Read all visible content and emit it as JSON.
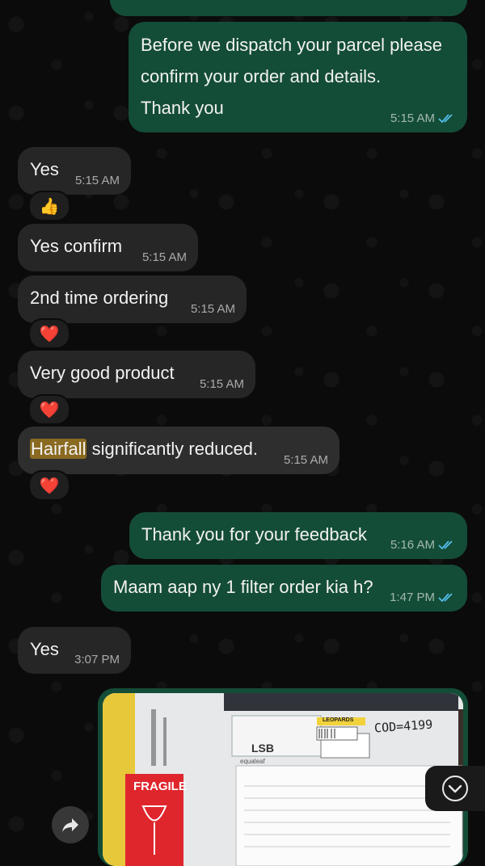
{
  "messages": [
    {
      "text_lines": [
        "Before we dispatch your parcel please",
        "confirm your order and details.",
        "Thank you"
      ],
      "time": "5:15 AM"
    },
    {
      "text": "Yes",
      "time": "5:15 AM",
      "reaction": "👍"
    },
    {
      "text": "Yes confirm",
      "time": "5:15 AM"
    },
    {
      "text": "2nd time ordering",
      "time": "5:15 AM",
      "reaction": "❤️"
    },
    {
      "text": "Very good product",
      "time": "5:15 AM",
      "reaction": "❤️"
    },
    {
      "text_highlight": "Hairfall",
      "text_rest": " significantly reduced.",
      "time": "5:15 AM",
      "reaction": "❤️"
    },
    {
      "text": "Thank you for your feedback",
      "time": "5:16 AM"
    },
    {
      "text": "Maam aap ny 1 filter order kia h?",
      "time": "1:47 PM"
    },
    {
      "text": "Yes",
      "time": "3:07 PM"
    }
  ],
  "photo": {
    "fragile_label": "FRAGILE",
    "handwriting": "COD=4199",
    "destination_code": "LSB",
    "courier_label": "LEOPARDS",
    "brand_label": "equaleaf"
  },
  "colors": {
    "outgoing_bubble": "#144d37",
    "incoming_bubble": "#262626",
    "read_ticks": "#53bdeb",
    "highlight": "#8a6a21"
  },
  "icons": [
    "read-ticks-icon",
    "forward-icon",
    "scroll-down-icon"
  ]
}
